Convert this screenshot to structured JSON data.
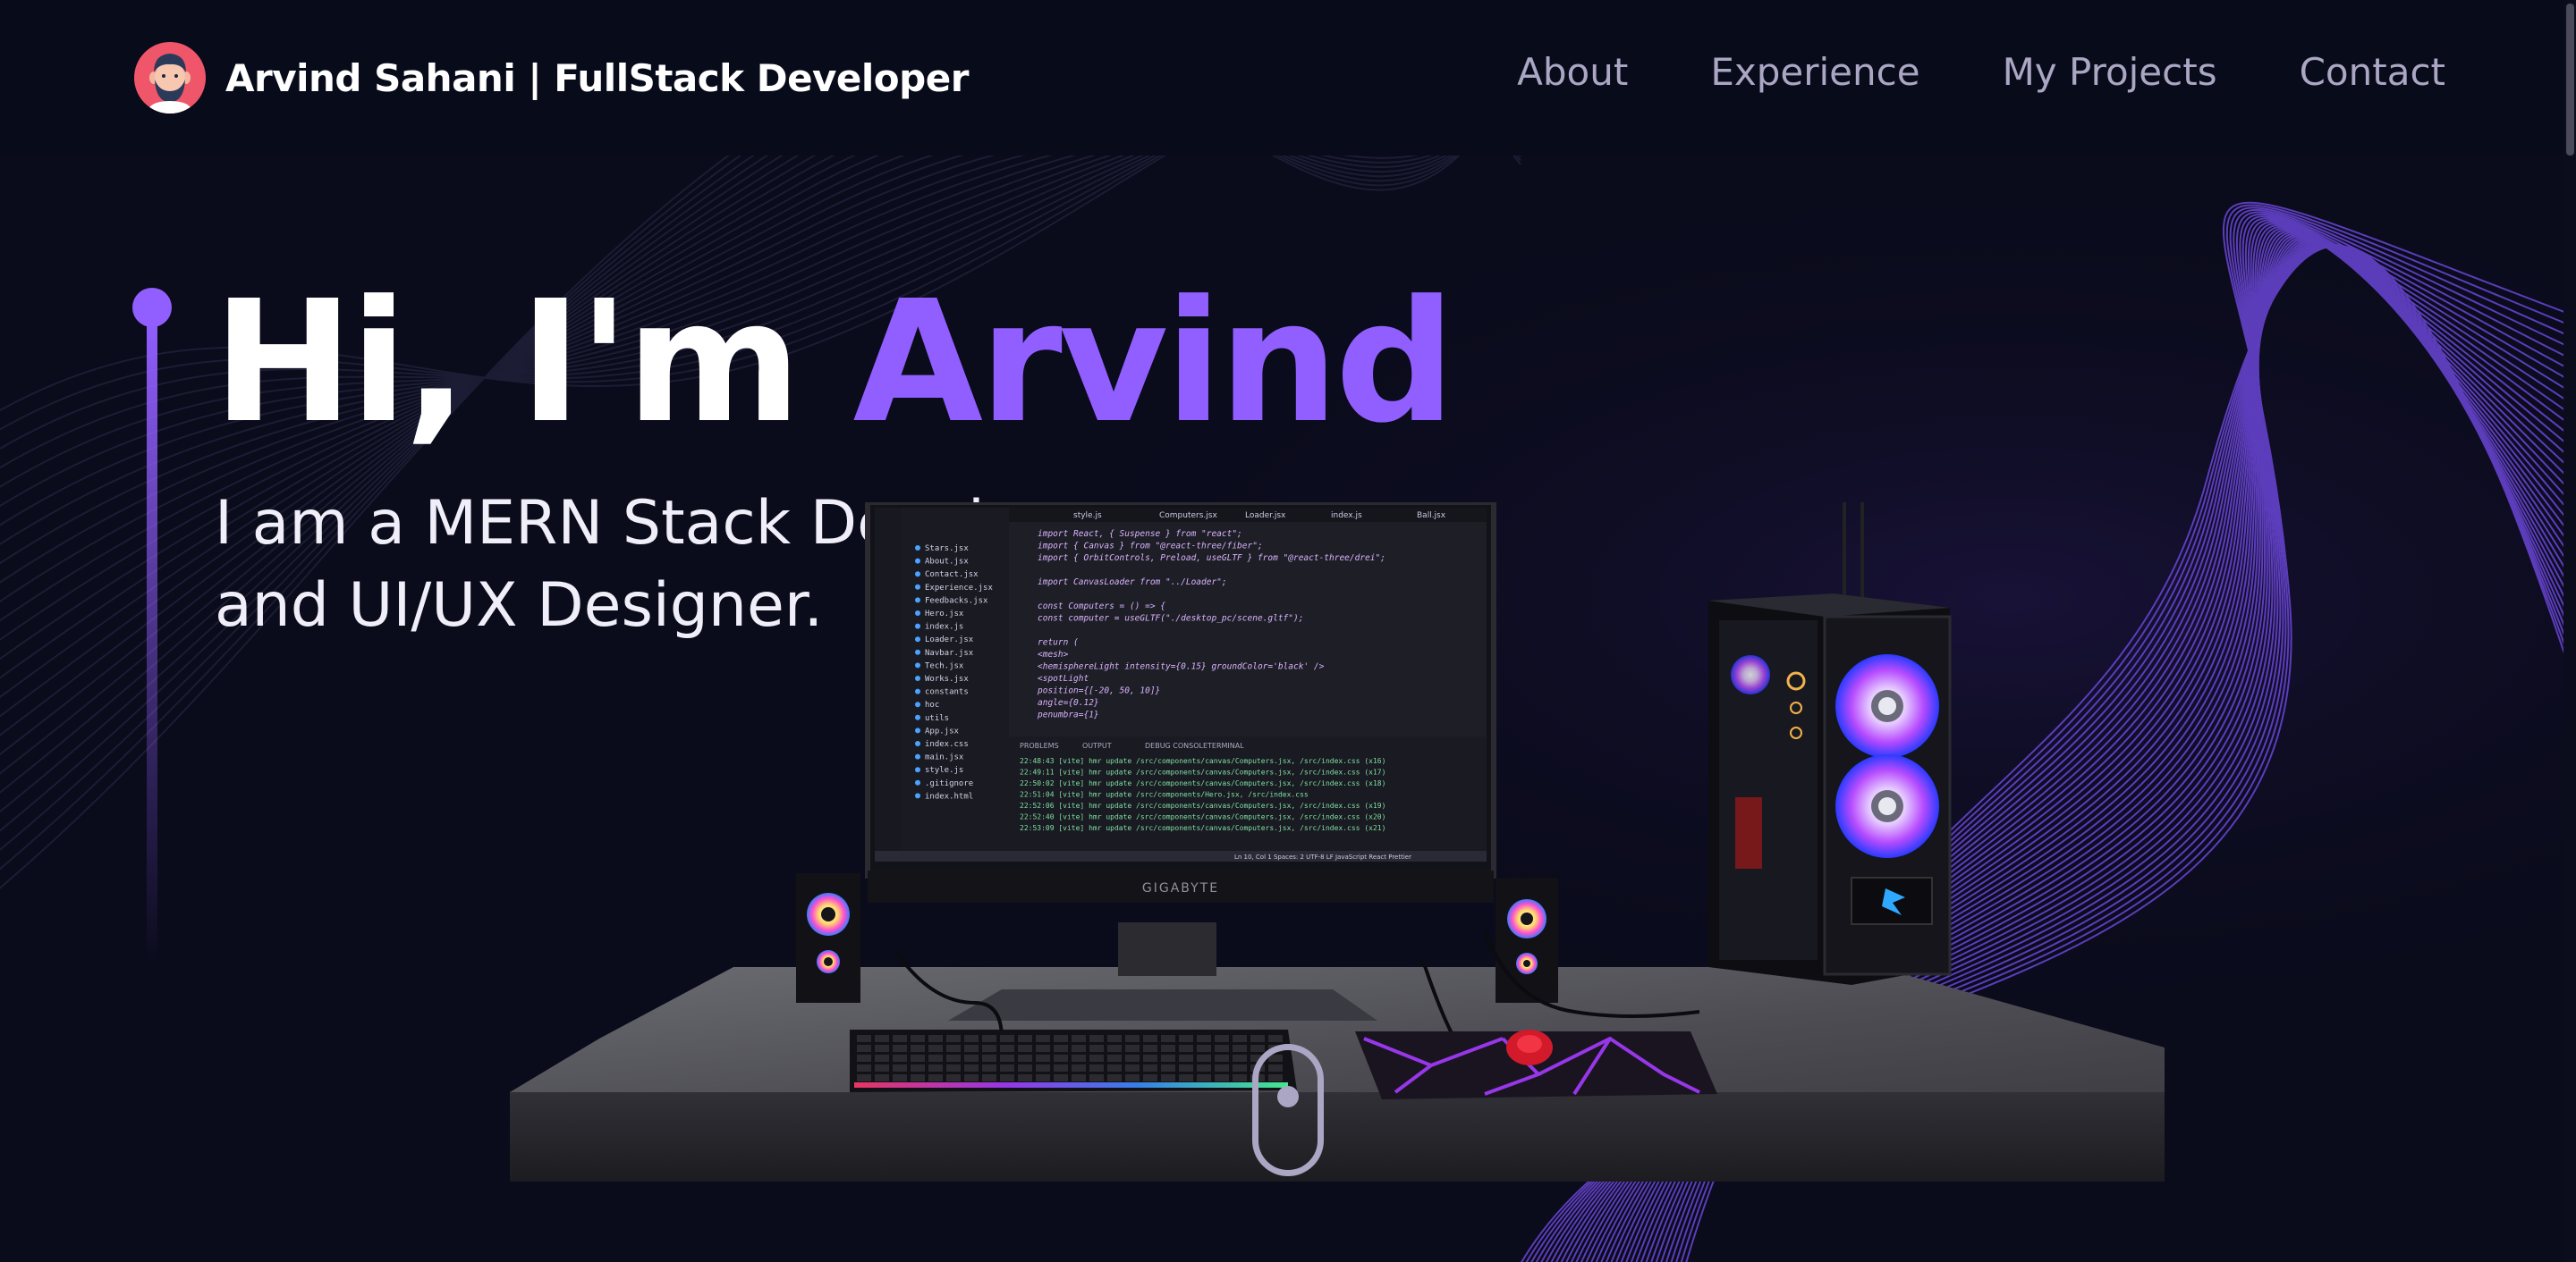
{
  "navbar": {
    "brand": "Arvind Sahani | FullStack Developer",
    "links": [
      "About",
      "Experience",
      "My Projects",
      "Contact"
    ]
  },
  "hero": {
    "greeting": "Hi, I'm ",
    "name": "Arvind",
    "subtitle_line1": "I am a MERN Stack Developer",
    "subtitle_line2": "and UI/UX Designer."
  },
  "scene": {
    "monitor_brand": "GIGABYTE",
    "editor_tabs": [
      "style.js",
      "Computers.jsx",
      "Loader.jsx",
      "index.js",
      "Ball.jsx"
    ],
    "explorer_files": [
      "Stars.jsx",
      "About.jsx",
      "Contact.jsx",
      "Experience.jsx",
      "Feedbacks.jsx",
      "Hero.jsx",
      "index.js",
      "Loader.jsx",
      "Navbar.jsx",
      "Tech.jsx",
      "Works.jsx",
      "constants",
      "hoc",
      "utils",
      "App.jsx",
      "index.css",
      "main.jsx",
      "style.js",
      ".gitignore",
      "index.html"
    ],
    "code_lines": [
      "import React, { Suspense } from \"react\";",
      "import { Canvas } from \"@react-three/fiber\";",
      "import { OrbitControls, Preload, useGLTF } from \"@react-three/drei\";",
      "",
      "import CanvasLoader from \"../Loader\";",
      "",
      "const Computers = () => {",
      "  const computer = useGLTF(\"./desktop_pc/scene.gltf\");",
      "",
      "  return (",
      "    <mesh>",
      "      <hemisphereLight intensity={0.15} groundColor='black' />",
      "      <spotLight",
      "        position={[-20, 50, 10]}",
      "        angle={0.12}",
      "        penumbra={1}"
    ],
    "terminal_tabs": [
      "PROBLEMS",
      "OUTPUT",
      "DEBUG CONSOLE",
      "TERMINAL"
    ],
    "terminal_lines": [
      "22:48:43 [vite] hmr update /src/components/canvas/Computers.jsx, /src/index.css (x16)",
      "22:49:11 [vite] hmr update /src/components/canvas/Computers.jsx, /src/index.css (x17)",
      "22:50:02 [vite] hmr update /src/components/canvas/Computers.jsx, /src/index.css (x18)",
      "22:51:04 [vite] hmr update /src/components/Hero.jsx, /src/index.css",
      "22:52:06 [vite] hmr update /src/components/canvas/Computers.jsx, /src/index.css (x19)",
      "22:52:40 [vite] hmr update /src/components/canvas/Computers.jsx, /src/index.css (x20)",
      "22:53:09 [vite] hmr update /src/components/canvas/Computers.jsx, /src/index.css (x21)"
    ],
    "status_bar": "Ln 10, Col 1   Spaces: 2   UTF-8   LF   JavaScript React   Prettier"
  },
  "colors": {
    "accent": "#915eff",
    "background": "#070813",
    "nav_text": "#aaa6c3",
    "white": "#ffffff"
  },
  "icons": [
    "avatar",
    "mouse-scroll-icon"
  ]
}
